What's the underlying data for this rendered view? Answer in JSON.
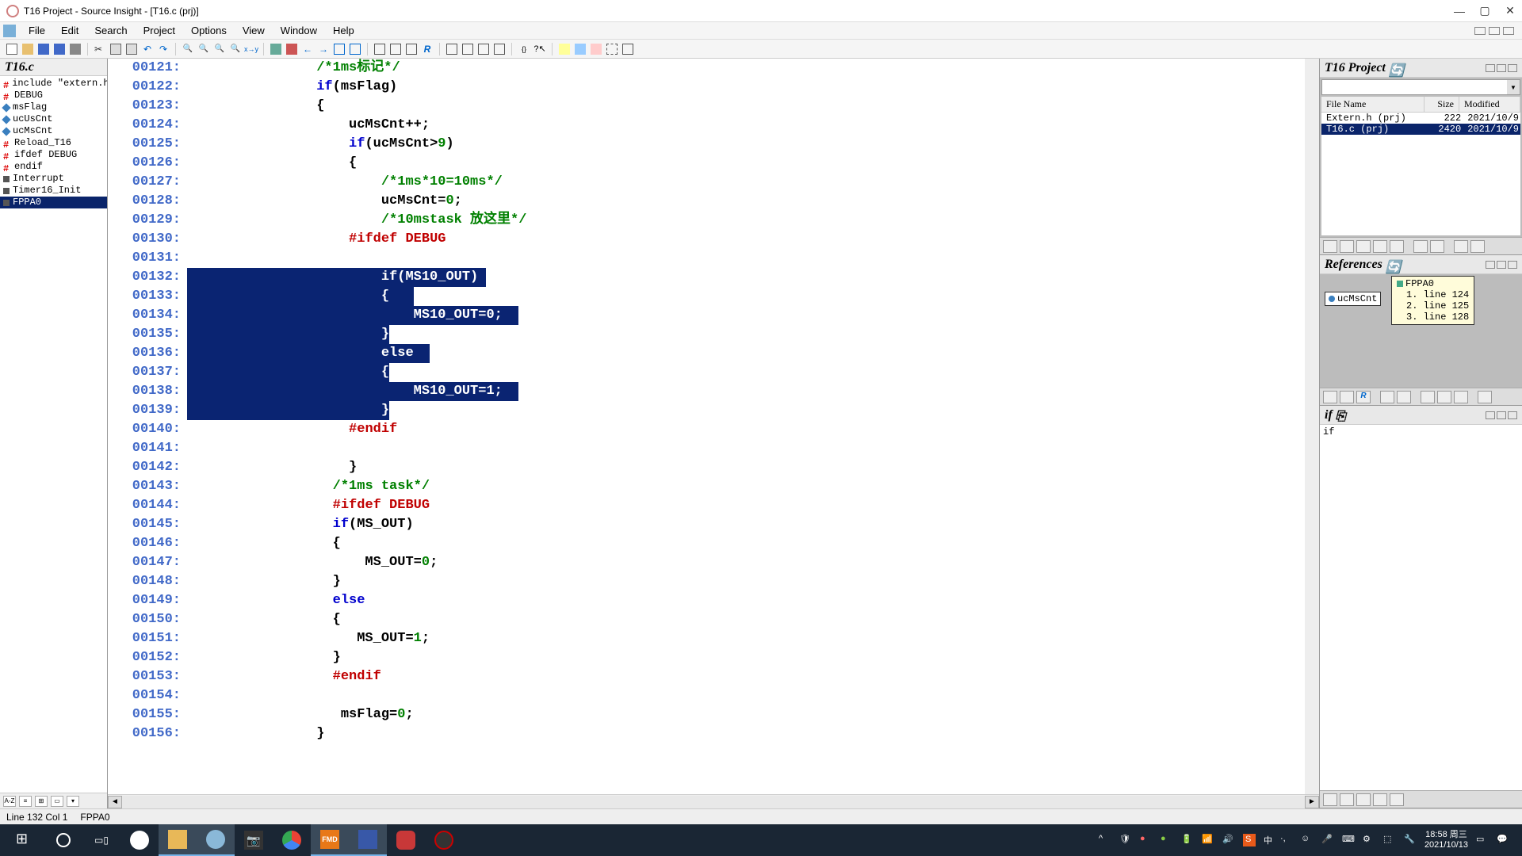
{
  "window": {
    "title": "T16 Project - Source Insight - [T16.c (prj)]"
  },
  "menus": [
    "File",
    "Edit",
    "Search",
    "Project",
    "Options",
    "View",
    "Window",
    "Help"
  ],
  "left": {
    "title": "T16.c",
    "symbols": [
      {
        "label": "include \"extern.h",
        "ic": "hash"
      },
      {
        "label": "DEBUG",
        "ic": "hash"
      },
      {
        "label": "msFlag",
        "ic": "diam"
      },
      {
        "label": "ucUsCnt",
        "ic": "diam"
      },
      {
        "label": "ucMsCnt",
        "ic": "diam"
      },
      {
        "label": "Reload_T16",
        "ic": "hash"
      },
      {
        "label": "ifdef DEBUG",
        "ic": "hash"
      },
      {
        "label": "endif",
        "ic": "hash"
      },
      {
        "label": "Interrupt",
        "ic": "box"
      },
      {
        "label": "Timer16_Init",
        "ic": "box"
      },
      {
        "label": "FPPA0",
        "ic": "box",
        "sel": true
      }
    ]
  },
  "code": {
    "lines": [
      {
        "n": "00121:",
        "seg": [
          {
            "t": "                ",
            "c": ""
          },
          {
            "t": "/*1ms标记*/",
            "c": "cm"
          }
        ]
      },
      {
        "n": "00122:",
        "seg": [
          {
            "t": "                ",
            "c": ""
          },
          {
            "t": "if",
            "c": "kw"
          },
          {
            "t": "(msFlag)",
            "c": "var"
          }
        ]
      },
      {
        "n": "00123:",
        "seg": [
          {
            "t": "                {",
            "c": "var"
          }
        ]
      },
      {
        "n": "00124:",
        "seg": [
          {
            "t": "                    ucMsCnt++;",
            "c": "var"
          }
        ]
      },
      {
        "n": "00125:",
        "seg": [
          {
            "t": "                    ",
            "c": ""
          },
          {
            "t": "if",
            "c": "kw"
          },
          {
            "t": "(ucMsCnt>",
            "c": "var"
          },
          {
            "t": "9",
            "c": "num"
          },
          {
            "t": ")",
            "c": "var"
          }
        ]
      },
      {
        "n": "00126:",
        "seg": [
          {
            "t": "                    {",
            "c": "var"
          }
        ]
      },
      {
        "n": "00127:",
        "seg": [
          {
            "t": "                        ",
            "c": ""
          },
          {
            "t": "/*1ms*10=10ms*/",
            "c": "cm"
          }
        ]
      },
      {
        "n": "00128:",
        "seg": [
          {
            "t": "                        ucMsCnt=",
            "c": "var"
          },
          {
            "t": "0",
            "c": "num"
          },
          {
            "t": ";",
            "c": "var"
          }
        ]
      },
      {
        "n": "00129:",
        "seg": [
          {
            "t": "                        ",
            "c": ""
          },
          {
            "t": "/*10mstask 放这里*/",
            "c": "cm"
          }
        ]
      },
      {
        "n": "00130:",
        "seg": [
          {
            "t": "                    ",
            "c": ""
          },
          {
            "t": "#ifdef DEBUG",
            "c": "pp"
          }
        ]
      },
      {
        "n": "00131:",
        "seg": [
          {
            "t": " ",
            "c": ""
          }
        ]
      },
      {
        "n": "00132:",
        "seg": [
          {
            "t": "                        if(MS10_OUT) ",
            "c": ""
          }
        ],
        "sel": true,
        "pad": 40
      },
      {
        "n": "00133:",
        "seg": [
          {
            "t": "                        {   ",
            "c": ""
          }
        ],
        "sel": true,
        "pad": 40
      },
      {
        "n": "00134:",
        "seg": [
          {
            "t": "                            MS10_OUT=0;  ",
            "c": ""
          }
        ],
        "sel": true,
        "pad": 40
      },
      {
        "n": "00135:",
        "seg": [
          {
            "t": "                        }",
            "c": ""
          }
        ],
        "sel": true,
        "pad": 40
      },
      {
        "n": "00136:",
        "seg": [
          {
            "t": "                        else  ",
            "c": ""
          }
        ],
        "sel": true,
        "pad": 40
      },
      {
        "n": "00137:",
        "seg": [
          {
            "t": "                        {",
            "c": ""
          }
        ],
        "sel": true,
        "pad": 40
      },
      {
        "n": "00138:",
        "seg": [
          {
            "t": "                            MS10_OUT=1;  ",
            "c": ""
          }
        ],
        "sel": true,
        "pad": 40
      },
      {
        "n": "00139:",
        "seg": [
          {
            "t": "                        }",
            "c": ""
          }
        ],
        "sel": true,
        "pad": 40
      },
      {
        "n": "00140:",
        "seg": [
          {
            "t": "                    ",
            "c": ""
          },
          {
            "t": "#endif",
            "c": "pp"
          }
        ]
      },
      {
        "n": "00141:",
        "seg": [
          {
            "t": " ",
            "c": ""
          }
        ]
      },
      {
        "n": "00142:",
        "seg": [
          {
            "t": "                    }",
            "c": "var"
          }
        ]
      },
      {
        "n": "00143:",
        "seg": [
          {
            "t": "                  ",
            "c": ""
          },
          {
            "t": "/*1ms task*/",
            "c": "cm"
          }
        ]
      },
      {
        "n": "00144:",
        "seg": [
          {
            "t": "                  ",
            "c": ""
          },
          {
            "t": "#ifdef DEBUG",
            "c": "pp"
          }
        ]
      },
      {
        "n": "00145:",
        "seg": [
          {
            "t": "                  ",
            "c": ""
          },
          {
            "t": "if",
            "c": "kw"
          },
          {
            "t": "(MS_OUT)",
            "c": "var"
          }
        ]
      },
      {
        "n": "00146:",
        "seg": [
          {
            "t": "                  {",
            "c": "var"
          }
        ]
      },
      {
        "n": "00147:",
        "seg": [
          {
            "t": "                      MS_OUT=",
            "c": "var"
          },
          {
            "t": "0",
            "c": "num"
          },
          {
            "t": ";",
            "c": "var"
          }
        ]
      },
      {
        "n": "00148:",
        "seg": [
          {
            "t": "                  }",
            "c": "var"
          }
        ]
      },
      {
        "n": "00149:",
        "seg": [
          {
            "t": "                  ",
            "c": ""
          },
          {
            "t": "else",
            "c": "kw"
          }
        ]
      },
      {
        "n": "00150:",
        "seg": [
          {
            "t": "                  {",
            "c": "var"
          }
        ]
      },
      {
        "n": "00151:",
        "seg": [
          {
            "t": "                     MS_OUT=",
            "c": "var"
          },
          {
            "t": "1",
            "c": "num"
          },
          {
            "t": ";",
            "c": "var"
          }
        ]
      },
      {
        "n": "00152:",
        "seg": [
          {
            "t": "                  }",
            "c": "var"
          }
        ]
      },
      {
        "n": "00153:",
        "seg": [
          {
            "t": "                  ",
            "c": ""
          },
          {
            "t": "#endif",
            "c": "pp"
          }
        ]
      },
      {
        "n": "00154:",
        "seg": [
          {
            "t": " ",
            "c": ""
          }
        ]
      },
      {
        "n": "00155:",
        "seg": [
          {
            "t": "                   msFlag=",
            "c": "var"
          },
          {
            "t": "0",
            "c": "num"
          },
          {
            "t": ";",
            "c": "var"
          }
        ]
      },
      {
        "n": "00156:",
        "seg": [
          {
            "t": "                }",
            "c": "var"
          }
        ]
      }
    ]
  },
  "project": {
    "title": "T16 Project",
    "cols": {
      "name": "File Name",
      "size": "Size",
      "mod": "Modified"
    },
    "files": [
      {
        "name": "Extern.h (prj)",
        "size": "222",
        "mod": "2021/10/9"
      },
      {
        "name": "T16.c (prj)",
        "size": "2420",
        "mod": "2021/10/9",
        "sel": true
      }
    ]
  },
  "refs": {
    "title": "References",
    "chip": "ucMsCnt",
    "box_title": "FPPA0",
    "items": [
      "1. line 124",
      "2. line 125",
      "3. line 128"
    ]
  },
  "ifpanel": {
    "title": "if",
    "text": "if"
  },
  "status": {
    "pos": "Line 132  Col 1",
    "ctx": "FPPA0"
  },
  "tray": {
    "ime": "中",
    "time": "18:58 周三",
    "date": "2021/10/13"
  }
}
